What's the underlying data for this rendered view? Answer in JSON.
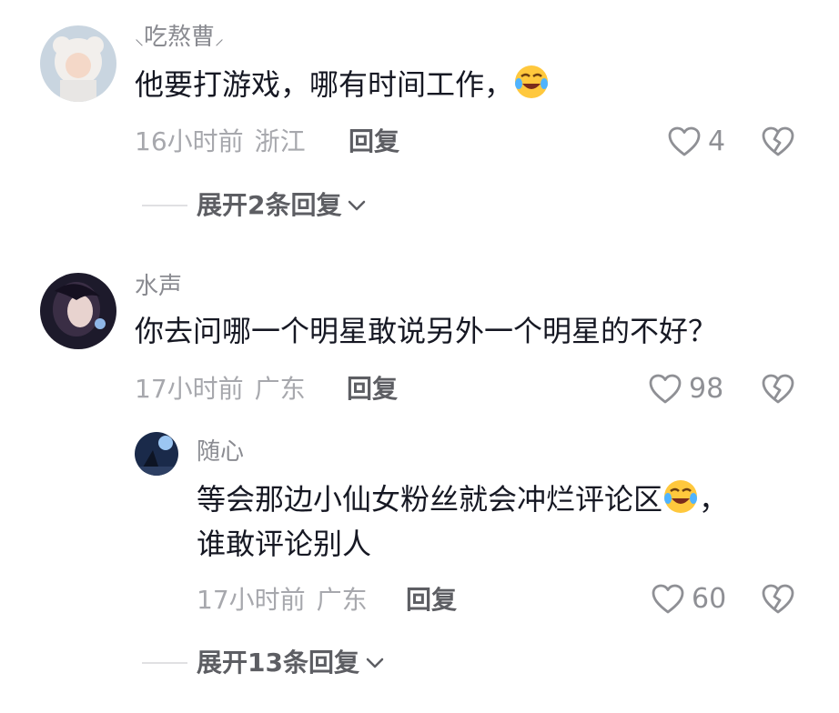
{
  "comments": [
    {
      "username": "吃熬曹",
      "text": "他要打游戏，哪有时间工作，",
      "time": "16小时前",
      "location": "浙江",
      "reply_label": "回复",
      "like_count": "4",
      "expand_label": "展开2条回复"
    },
    {
      "username": "水声",
      "text": "你去问哪一个明星敢说另外一个明星的不好？",
      "time": "17小时前",
      "location": "广东",
      "reply_label": "回复",
      "like_count": "98",
      "reply": {
        "username": "随心",
        "text_line1": "等会那边小仙女粉丝就会冲烂评论区",
        "text_line1_end": "，",
        "text_line2": "谁敢评论别人",
        "time": "17小时前",
        "location": "广东",
        "reply_label": "回复",
        "like_count": "60"
      },
      "expand_label": "展开13条回复"
    }
  ],
  "icons": {
    "like": "heart-outline-icon",
    "dislike": "broken-heart-icon",
    "emoji": "laughing-crying-emoji",
    "chevron": "chevron-down-icon"
  }
}
